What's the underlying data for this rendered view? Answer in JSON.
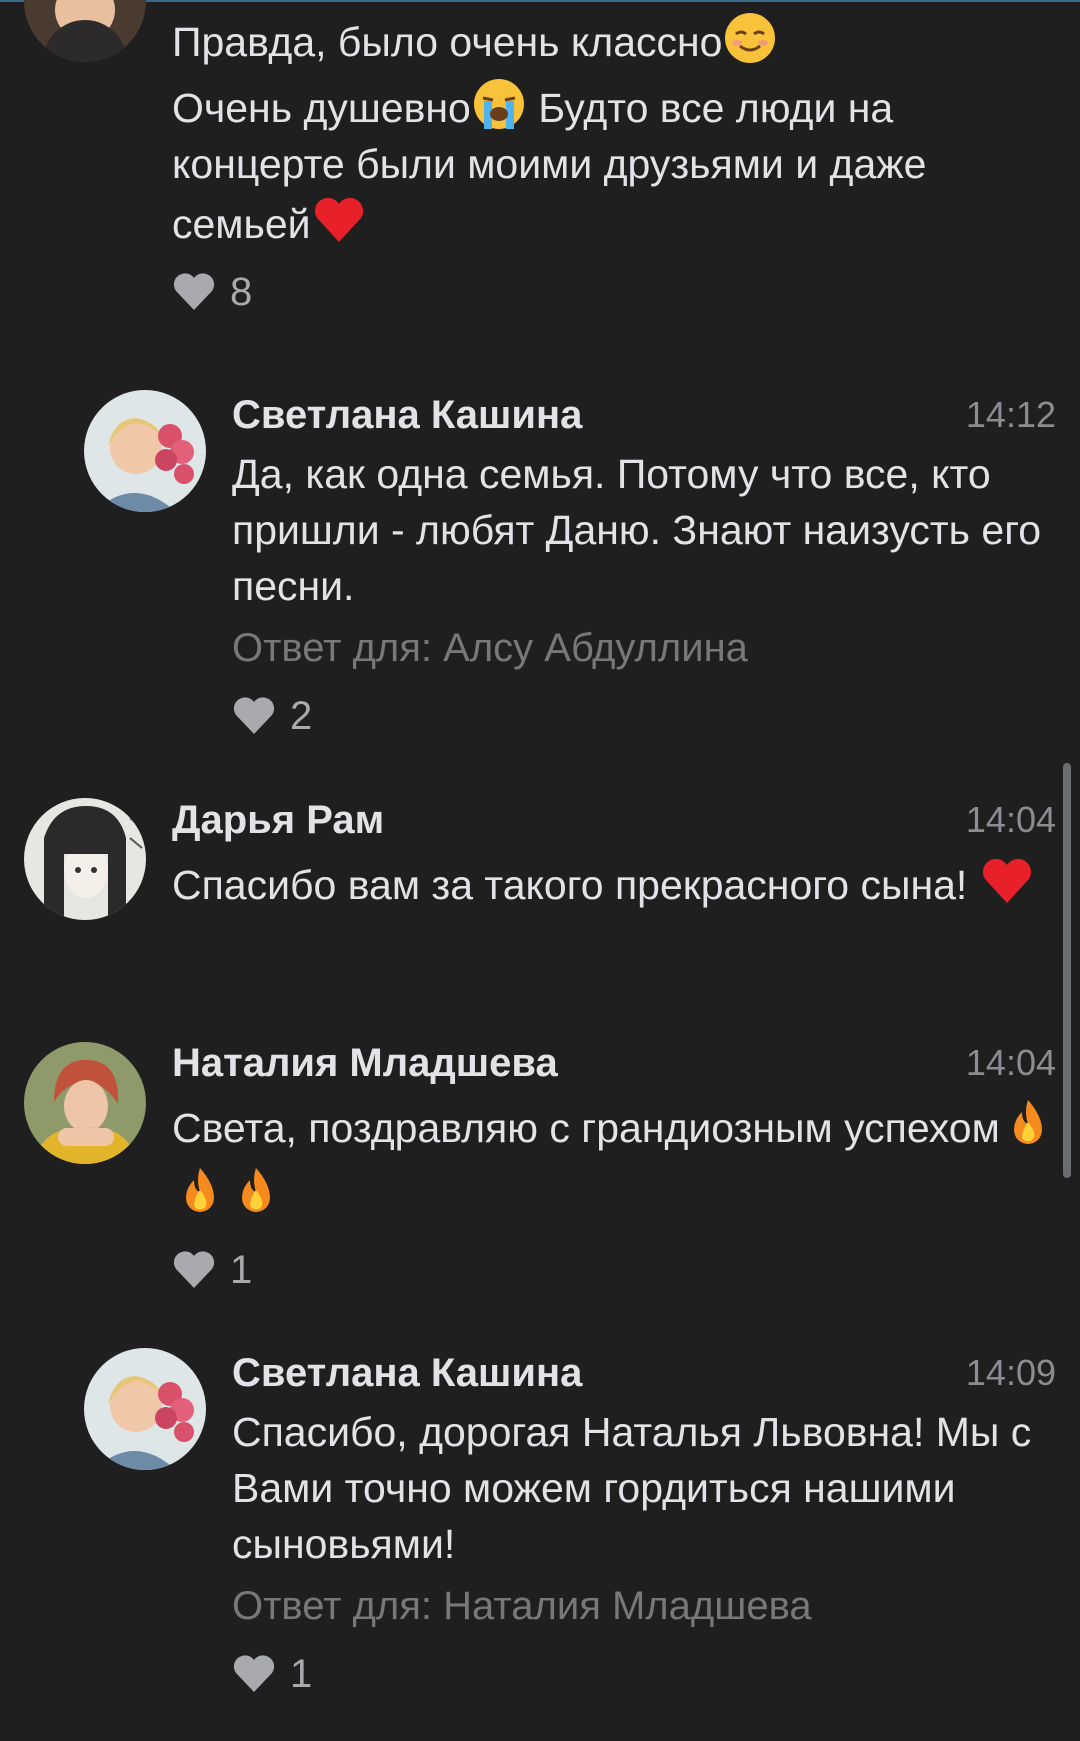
{
  "comments": [
    {
      "lines": [
        "Правда, было очень классно",
        "Очень душевно",
        " Будто все люди на концерте были моими друзьями и даже семьей"
      ],
      "emojis": [
        "smiling-blush-emoji",
        "loudly-crying-emoji",
        "red-heart-emoji"
      ],
      "likes": "8"
    },
    {
      "author": "Светлана Кашина",
      "time": "14:12",
      "text": "Да, как одна семья. Потому что все, кто пришли - любят Даню. Знают наизусть его песни.",
      "reply_to": "Ответ для: Алсу Абдуллина",
      "likes": "2"
    },
    {
      "author": "Дарья Рам",
      "time": "14:04",
      "text": "Спасибо вам за такого прекрасного сына! ",
      "emojis": [
        "red-heart-emoji"
      ]
    },
    {
      "author": "Наталия Младшева",
      "time": "14:04",
      "text": "Света, поздравляю с грандиозным успехом",
      "emojis": [
        "fire-emoji",
        "fire-emoji",
        "fire-emoji"
      ],
      "likes": "1"
    },
    {
      "author": "Светлана Кашина",
      "time": "14:09",
      "text": "Спасибо, дорогая Наталья Львовна! Мы с Вами точно можем гордиться нашими сыновьями!",
      "reply_to": "Ответ для: Наталия Младшева",
      "likes": "1"
    }
  ],
  "colors": {
    "background": "#1f1f1f",
    "text": "#e1e3e6",
    "secondary": "#8a8d91",
    "muted": "#76787a"
  }
}
